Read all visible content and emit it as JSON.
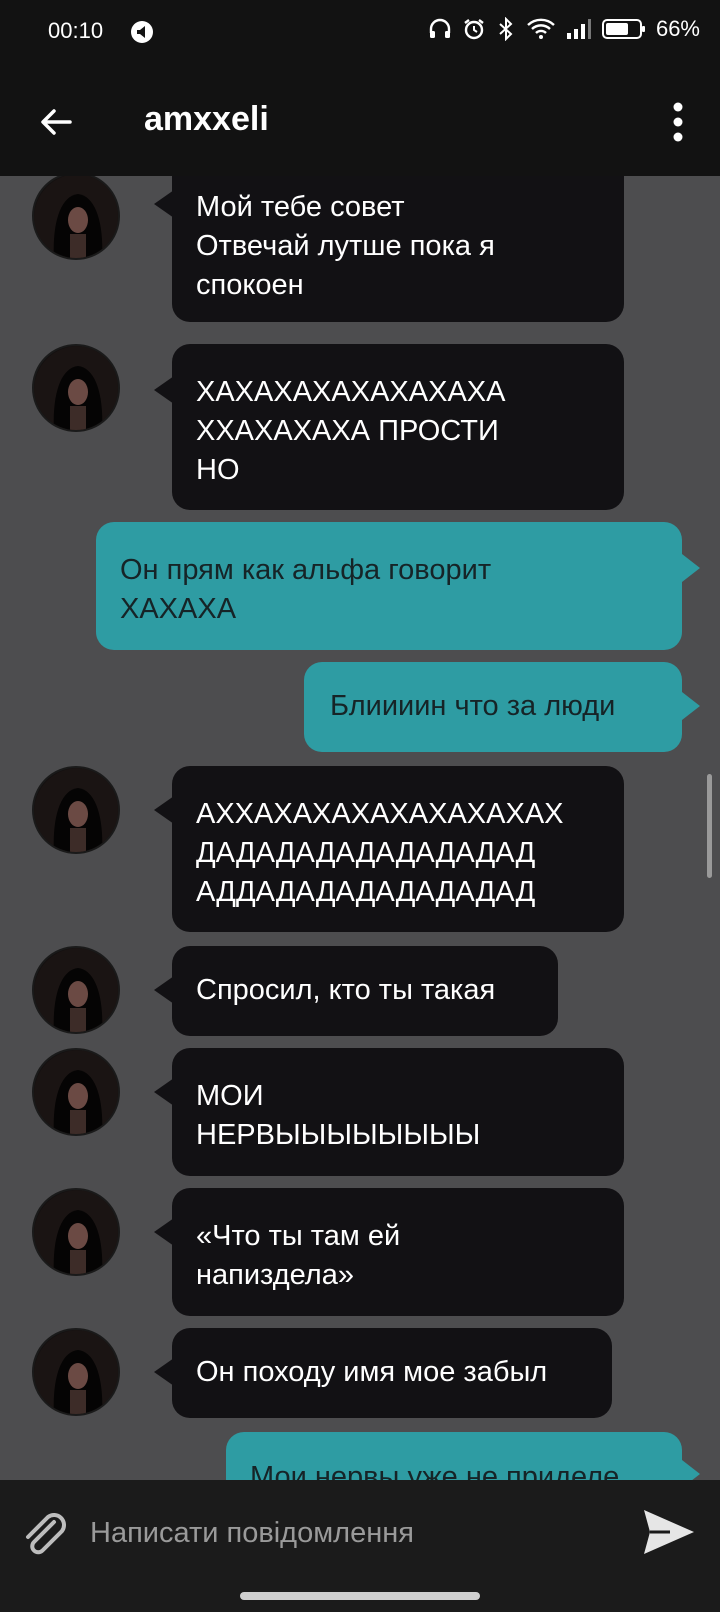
{
  "status": {
    "time": "00:10",
    "battery": "66%",
    "icons": [
      "notification-icon",
      "headphones-icon",
      "alarm-icon",
      "bluetooth-icon",
      "wifi-icon",
      "signal-icon",
      "battery-icon"
    ]
  },
  "header": {
    "title": "amxxeli",
    "icons": [
      "back-arrow-icon",
      "more-vert-icon"
    ]
  },
  "messages": [
    {
      "direction": "incoming",
      "text": "Мой тебе совет\nОтвечай лутше пока я\nспокоен"
    },
    {
      "direction": "incoming",
      "text": "ХАХАХАХАХАХАХАХА\nХХАХАХАХА ПРОСТИ\nНО"
    },
    {
      "direction": "outgoing",
      "text": "Он прям как альфа говорит\nХАХАХА"
    },
    {
      "direction": "outgoing",
      "text": "Блиииин что за люди"
    },
    {
      "direction": "incoming",
      "text": "АХХАХАХАХАХАХАХАХАХ\nДАДАДАДАДАДАДАДАД\nАДДАДАДАДАДАДАДАД"
    },
    {
      "direction": "incoming",
      "text": "Спросил, кто ты такая"
    },
    {
      "direction": "incoming",
      "text": "МОИ\nНЕРВЫЫЫЫЫЫЫЫ"
    },
    {
      "direction": "incoming",
      "text": "«Что ты там ей\nнапиздела»"
    },
    {
      "direction": "incoming",
      "text": "Он походу имя мое забыл"
    },
    {
      "direction": "outgoing",
      "text": "Мои нервы уже не приделе"
    }
  ],
  "composer": {
    "placeholder": "Написати повідомлення"
  },
  "colors": {
    "incoming_bubble": "#121114",
    "outgoing_bubble": "#2e9ca3",
    "background": "#4d4d4f",
    "bars": "#121212"
  }
}
